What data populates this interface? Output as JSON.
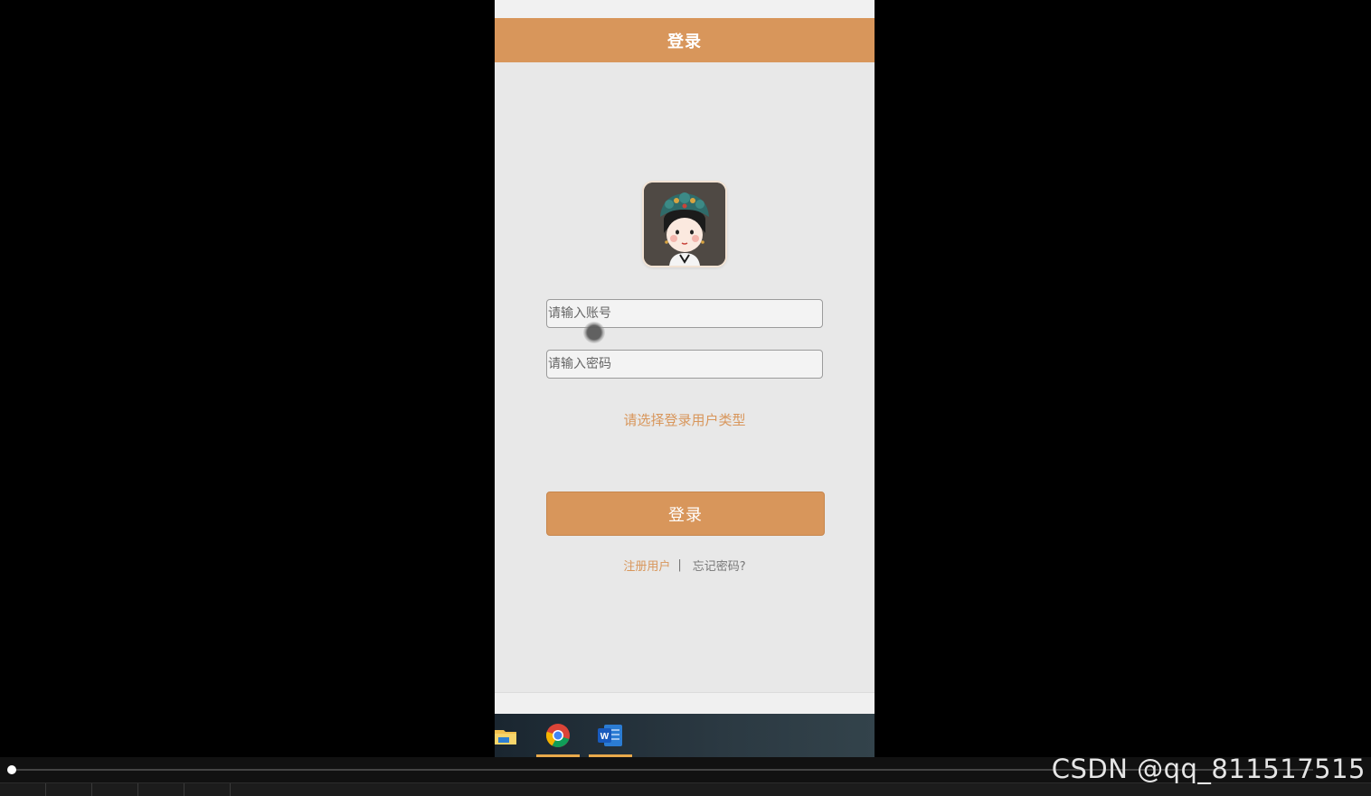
{
  "header": {
    "title": "登录"
  },
  "form": {
    "account_placeholder": "请输入账号",
    "password_placeholder": "请输入密码",
    "user_type_prompt": "请选择登录用户类型",
    "login_button": "登录"
  },
  "links": {
    "register": "注册用户",
    "separator": "|",
    "forgot": "忘记密码?"
  },
  "taskbar": {
    "icons": [
      "file-explorer-icon",
      "chrome-icon",
      "word-icon"
    ]
  },
  "watermark": "CSDN @qq_811517515",
  "colors": {
    "accent": "#d8965b",
    "page_bg": "#e8e8e8",
    "outer_bg": "#000000"
  }
}
